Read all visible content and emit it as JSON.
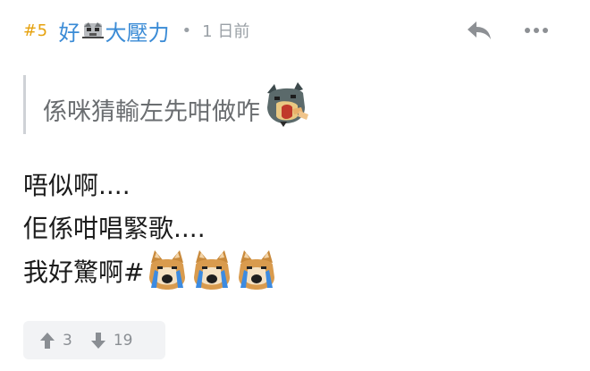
{
  "post": {
    "floor": "#5",
    "username_before": "好",
    "username_after": "大壓力",
    "separator": "•",
    "time": "1 日前",
    "quote": "係咪猜輸左先咁做咋",
    "body": {
      "line1": "唔似啊....",
      "line2": "佢係咁唱緊歌....",
      "line3": "我好驚啊#"
    },
    "upvotes": "3",
    "downvotes": "19"
  },
  "icons": {
    "reply": "reply-arrow-icon",
    "more": "more-dots-icon",
    "upvote": "arrow-up-icon",
    "downvote": "arrow-down-icon"
  },
  "colors": {
    "floor": "#e6a20e",
    "username": "#3a8bd6",
    "meta": "#9aa0a6",
    "vote_bg": "#f2f3f5"
  }
}
